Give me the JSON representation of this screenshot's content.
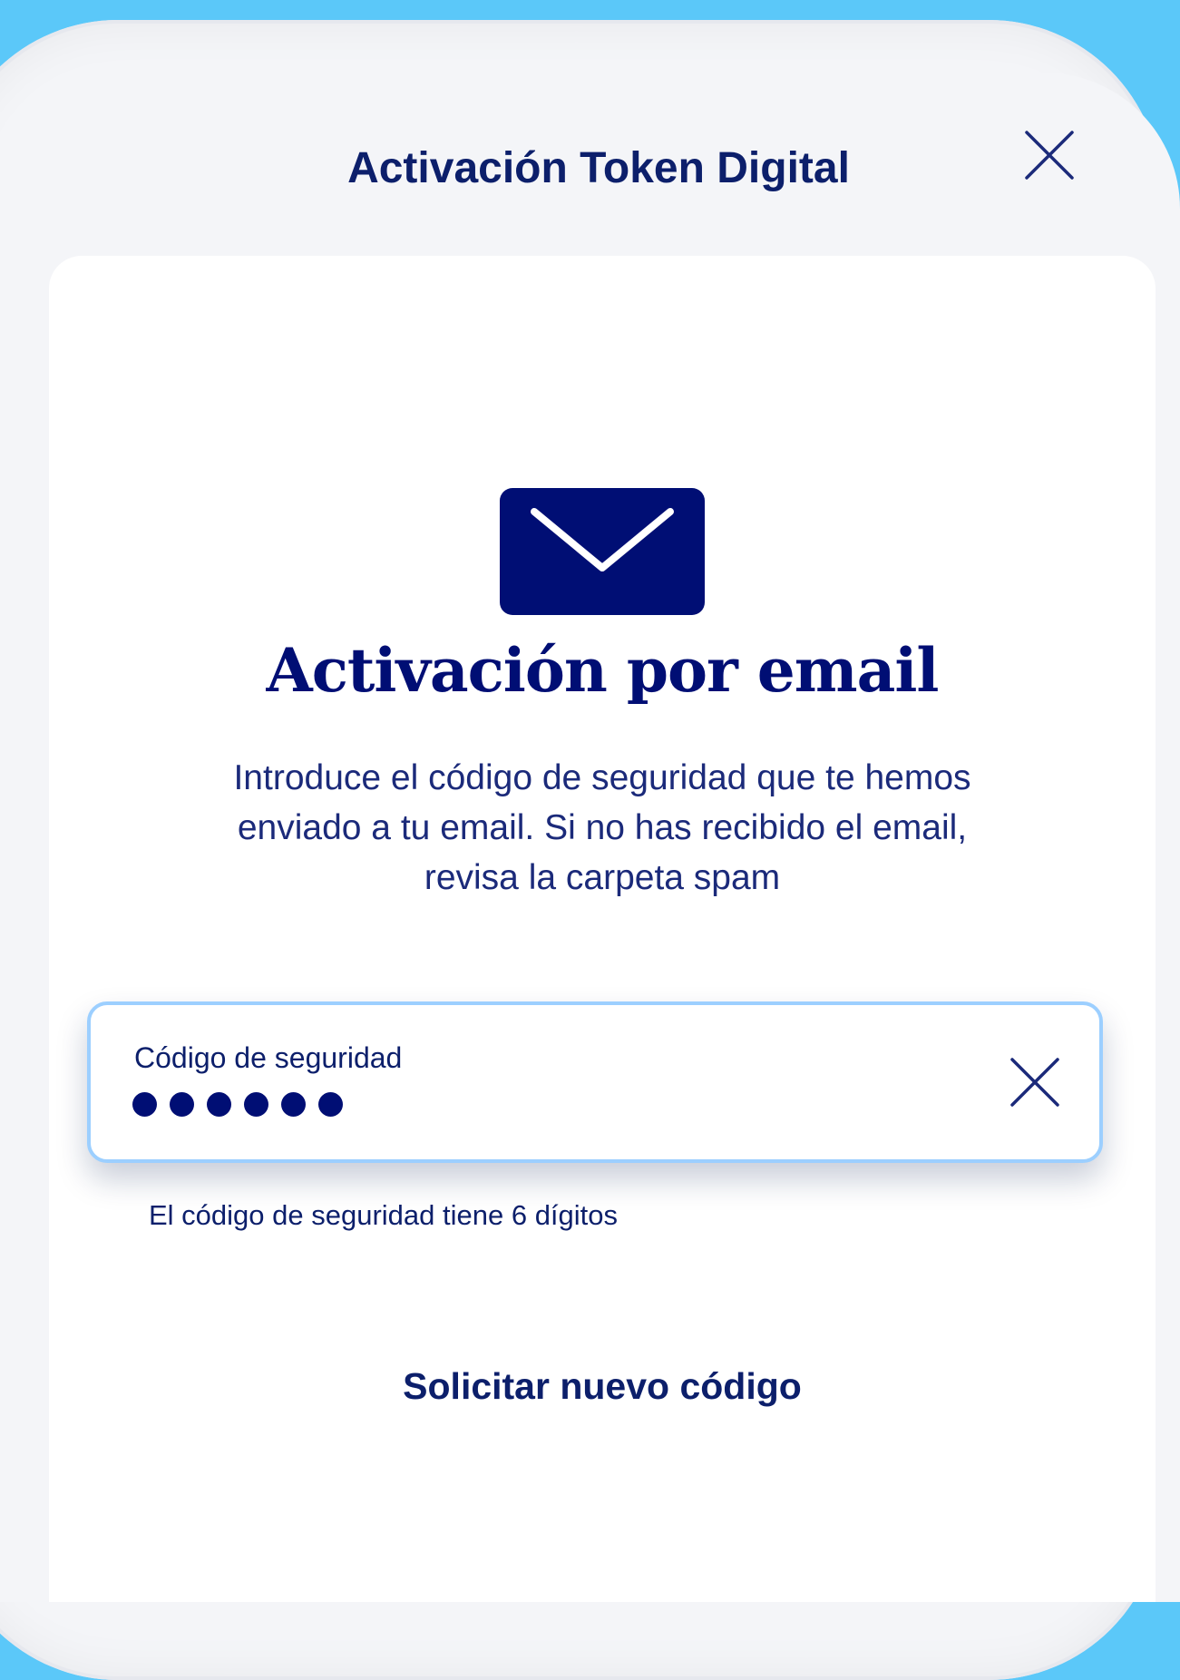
{
  "header": {
    "title": "Activación Token Digital",
    "close_icon": "close-icon"
  },
  "main": {
    "icon": "envelope-icon",
    "title": "Activación por email",
    "description": "Introduce el código de seguridad que te hemos enviado a tu email. Si no has recibido el email, revisa la carpeta spam",
    "code_field": {
      "label": "Código de seguridad",
      "value_masked": "••••••",
      "digits_entered": 6,
      "clear_icon": "close-icon"
    },
    "helper_text": "El código de seguridad tiene 6 dígitos",
    "request_new_code_label": "Solicitar nuevo código"
  },
  "colors": {
    "background": "#5bc8f9",
    "primary_navy": "#000e74",
    "text_navy": "#0c1f6b",
    "field_focus_border": "#9ccfff",
    "surface": "#ffffff",
    "header_bg": "#f4f5f8"
  }
}
